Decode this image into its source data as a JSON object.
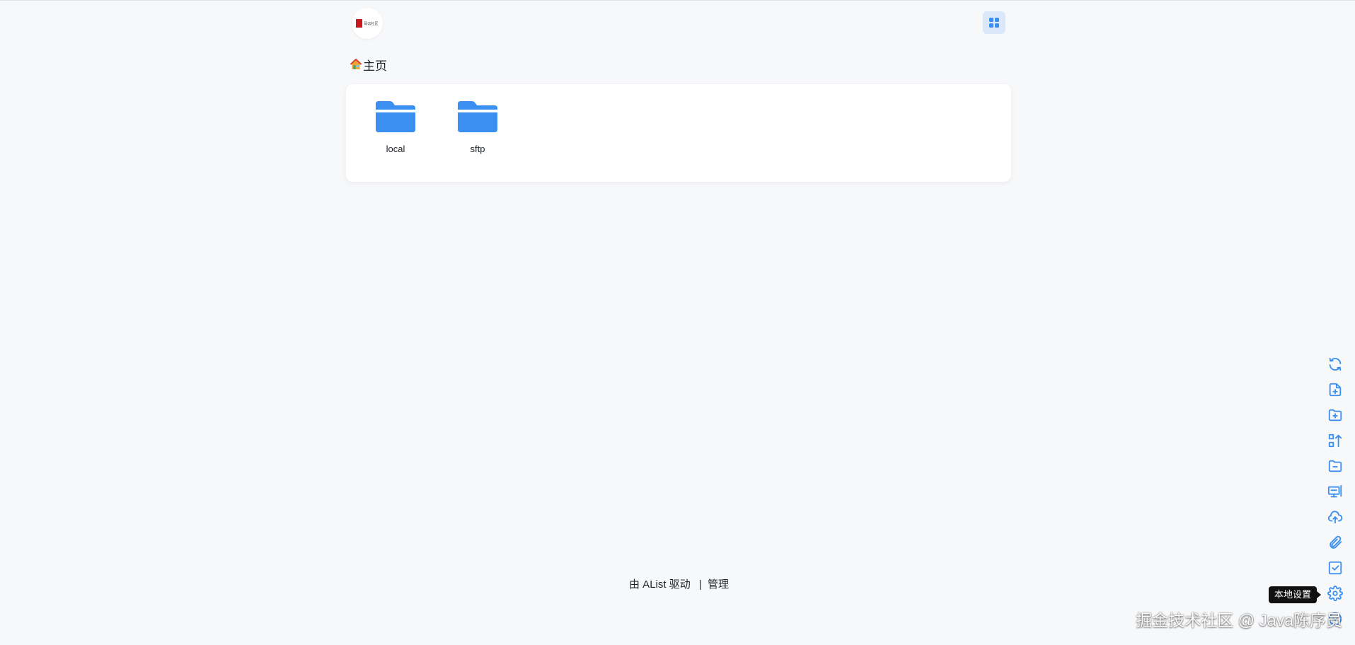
{
  "header": {
    "logo_text": "码云社区",
    "layout_toggle_icon": "grid-icon"
  },
  "breadcrumb": {
    "home_icon": "house-icon",
    "home_label": "主页"
  },
  "files": [
    {
      "name": "local",
      "type": "folder"
    },
    {
      "name": "sftp",
      "type": "folder"
    }
  ],
  "footer": {
    "powered_by": "由 AList 驱动",
    "separator": "|",
    "manage_link": "管理"
  },
  "toolbar": {
    "items": [
      {
        "icon": "refresh-icon"
      },
      {
        "icon": "new-file-icon"
      },
      {
        "icon": "new-folder-icon"
      },
      {
        "icon": "sort-icon"
      },
      {
        "icon": "delete-folder-icon"
      },
      {
        "icon": "monitor-icon"
      },
      {
        "icon": "upload-cloud-icon"
      },
      {
        "icon": "paperclip-icon"
      },
      {
        "icon": "checkbox-icon"
      },
      {
        "icon": "gear-icon"
      },
      {
        "icon": "more-icon"
      }
    ],
    "tooltip": "本地设置"
  },
  "watermark": "掘金技术社区 @ Java陈序员",
  "colors": {
    "accent": "#3b8ff0",
    "background": "#f7f8fa",
    "card": "#ffffff"
  }
}
